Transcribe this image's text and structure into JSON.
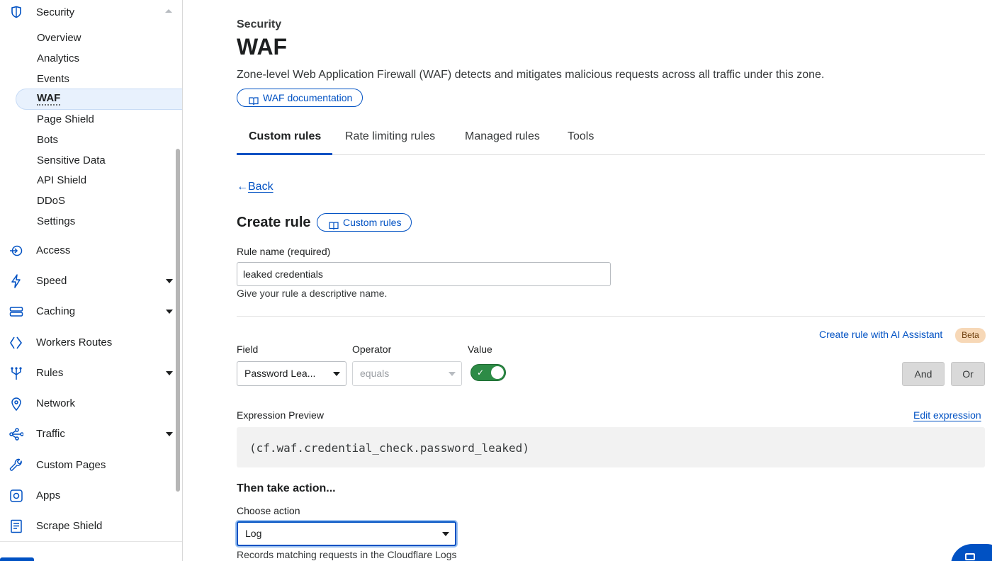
{
  "sidebar": {
    "section": {
      "label": "Security"
    },
    "subitems": [
      "Overview",
      "Analytics",
      "Events",
      "WAF",
      "Page Shield",
      "Bots",
      "Sensitive Data",
      "API Shield",
      "DDoS",
      "Settings"
    ],
    "items": [
      {
        "label": "Access",
        "icon": "access-icon",
        "has_caret": false
      },
      {
        "label": "Speed",
        "icon": "lightning-icon",
        "has_caret": true
      },
      {
        "label": "Caching",
        "icon": "server-icon",
        "has_caret": true
      },
      {
        "label": "Workers Routes",
        "icon": "workers-icon",
        "has_caret": false
      },
      {
        "label": "Rules",
        "icon": "fork-icon",
        "has_caret": true
      },
      {
        "label": "Network",
        "icon": "location-pin-icon",
        "has_caret": false
      },
      {
        "label": "Traffic",
        "icon": "share-nodes-icon",
        "has_caret": true
      },
      {
        "label": "Custom Pages",
        "icon": "wrench-icon",
        "has_caret": false
      },
      {
        "label": "Apps",
        "icon": "apps-icon",
        "has_caret": false
      },
      {
        "label": "Scrape Shield",
        "icon": "document-icon",
        "has_caret": false
      }
    ]
  },
  "header": {
    "eyebrow": "Security",
    "title": "WAF",
    "description": "Zone-level Web Application Firewall (WAF) detects and mitigates malicious requests across all traffic under this zone.",
    "doc_link": "WAF documentation"
  },
  "tabs": [
    "Custom rules",
    "Rate limiting rules",
    "Managed rules",
    "Tools"
  ],
  "form": {
    "back_arrow": "←",
    "back": "Back",
    "heading": "Create rule",
    "heading_link": "Custom rules",
    "rule_name_label": "Rule name (required)",
    "rule_name_value": "leaked credentials",
    "rule_name_help": "Give your rule a descriptive name.",
    "ai_link": "Create rule with AI Assistant",
    "ai_badge": "Beta",
    "field_label": "Field",
    "field_value": "Password Lea...",
    "operator_label": "Operator",
    "operator_value": "equals",
    "value_label": "Value",
    "value_toggle": "✓",
    "and_button": "And",
    "or_button": "Or",
    "expression_label": "Expression Preview",
    "edit_expression": "Edit expression",
    "expression": "(cf.waf.credential_check.password_leaked)",
    "action_heading": "Then take action...",
    "action_label": "Choose action",
    "action_value": "Log",
    "action_help": "Records matching requests in the Cloudflare Logs"
  },
  "colors": {
    "accent": "#0051c3",
    "toggle_on": "#2d8b46",
    "beta_bg": "#f7d8b7",
    "active_nav_bg": "#e8f1fd"
  }
}
